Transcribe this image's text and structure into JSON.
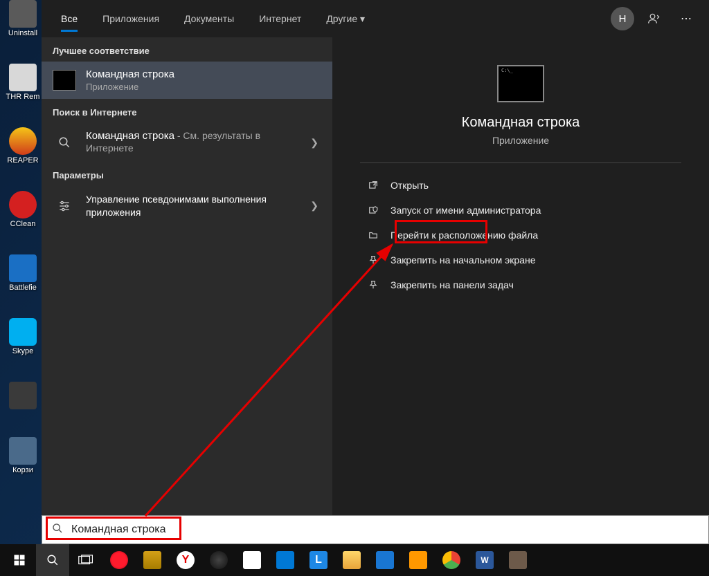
{
  "desktop": {
    "icons": [
      "Uninstall",
      "THR Rem",
      "REAPER",
      "CClean",
      "Battlefie",
      "Skype",
      "",
      "Корзи"
    ]
  },
  "tabs": {
    "items": [
      "Все",
      "Приложения",
      "Документы",
      "Интернет",
      "Другие"
    ],
    "avatar_initial": "Н"
  },
  "left": {
    "best_match_header": "Лучшее соответствие",
    "best_match": {
      "title": "Командная строка",
      "subtitle": "Приложение"
    },
    "web_header": "Поиск в Интернете",
    "web_result": {
      "title": "Командная строка",
      "suffix": " - См. результаты в Интернете"
    },
    "settings_header": "Параметры",
    "settings_result": {
      "title": "Управление псевдонимами выполнения приложения"
    }
  },
  "preview": {
    "title": "Командная строка",
    "subtitle": "Приложение",
    "actions": [
      {
        "icon": "↗",
        "label": "Открыть"
      },
      {
        "icon": "⛊",
        "label": "Запуск от имени администратора"
      },
      {
        "icon": "📁",
        "label": "Перейти к расположению файла"
      },
      {
        "icon": "📌",
        "label": "Закрепить на начальном экране"
      },
      {
        "icon": "📍",
        "label": "Закрепить на панели задач"
      }
    ]
  },
  "search": {
    "value": "Командная строка"
  }
}
